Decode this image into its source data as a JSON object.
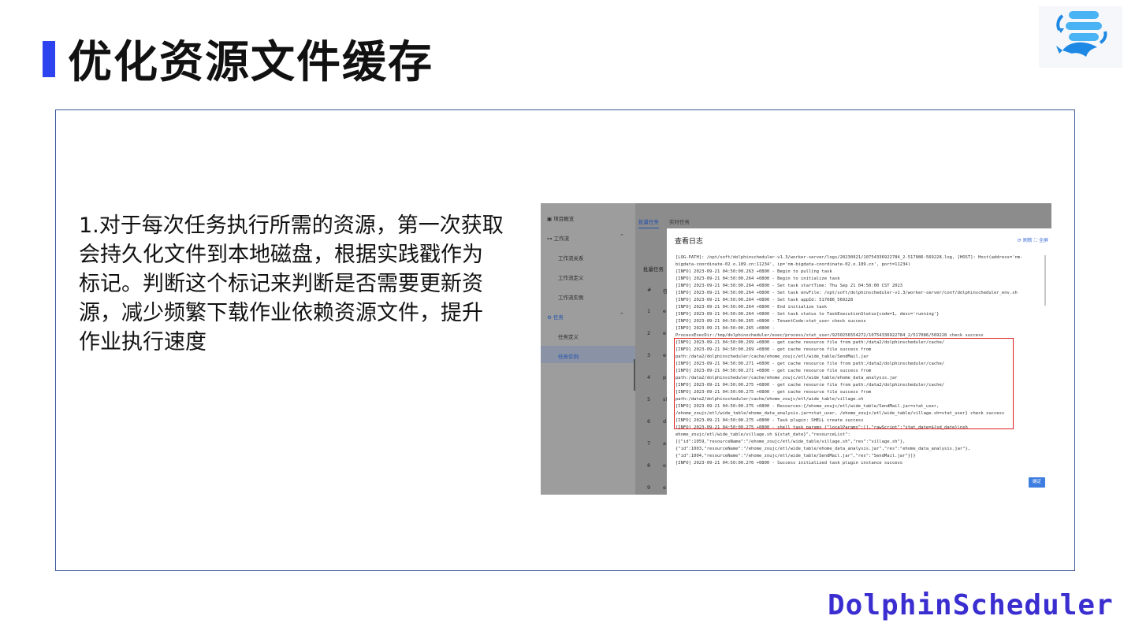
{
  "slide": {
    "title": "优化资源文件缓存",
    "body_lines": [
      "1.对于每次任务执行所需的资源，第一次获取",
      "会持久化文件到本地磁盘，根据实践戳作为",
      "标记。判断这个标记来判断是否需要更新资",
      "源，减少频繁下载作业依赖资源文件，提升",
      "作业执行速度"
    ],
    "brand": "DolphinScheduler"
  },
  "screenshot": {
    "sidebar": {
      "items": [
        "项目概览",
        "工作流",
        "工作流关系",
        "工作流定义",
        "工作流实例",
        "任务",
        "任务定义",
        "任务实例"
      ]
    },
    "tabs": [
      "批量任务",
      "实时任务"
    ],
    "background_label": "批量任务",
    "row_numbers": [
      "#",
      "1",
      "2",
      "3",
      "4",
      "5",
      "6",
      "7",
      "8",
      "9"
    ],
    "row_letters": [
      "任",
      "e",
      "e",
      "e",
      "p",
      "sl",
      "d",
      "a",
      "o",
      "e"
    ],
    "dialog": {
      "title": "查看日志",
      "refresh": "刷新",
      "fullscreen": "全屏",
      "ok": "确定",
      "log_lines": [
        "[LOG-PATH]: /opt/soft/dolphinscheduler-v1.3/worker-server/logs/20230921/10754336922784_2-517086-569228.log, [HOST]:  Host(address='nm-",
        "bigdata-coordinate-02.o.189.cn:11234', ip='nm-bigdata-coordinate-02.o.189.cn', port=11234)",
        "[INFO] 2023-09-21 04:50:00.263 +0800 - Begin to pulling task",
        "[INFO] 2023-09-21 04:50:00.264 +0800 - Begin to initialize task",
        "[INFO] 2023-09-21 04:50:00.264 +0800 - Set task startTime: Thu Sep 21 04:50:00 CST 2023",
        "[INFO] 2023-09-21 04:50:00.264 +0800 - Set task envFile: /opt/soft/dolphinscheduler-v1.3/worker-server/conf/dolphinscheduler_env.sh",
        "[INFO] 2023-09-21 04:50:00.264 +0800 - Set task appId: 517086_569228",
        "[INFO] 2023-09-21 04:50:00.264 +0800 - End initialize task",
        "[INFO] 2023-09-21 04:50:00.264 +0800 - Set task status to TaskExecutionStatus{code=1, desc='running'}",
        "[INFO] 2023-09-21 04:50:00.265 +0800 - TenantCode:stat_user check success",
        "[INFO] 2023-09-21 04:50:00.265 +0800 -",
        "ProcessExecDir:/tmp/dolphinscheduler/exec/process/stat_user/9250256554272/10754336922784_2/517086/569228 check success",
        "[INFO] 2023-09-21 04:50:00.269 +0800 - get cache resource file from path:/data2/dolphinscheduler/cache/",
        "[INFO] 2023-09-21 04:50:00.269 +0800 - get cache resource file success from",
        "path:/data2/dolphinscheduler/cache/ehome_zoujc/etl/wide_table/SendMail.jar",
        "[INFO] 2023-09-21 04:50:00.271 +0800 - get cache resource file from path:/data2/dolphinscheduler/cache/",
        "[INFO] 2023-09-21 04:50:00.271 +0800 - get cache resource file success from",
        "path:/data2/dolphinscheduler/cache/ehome_zoujc/etl/wide_table/ehome_data_analysis.jar",
        "[INFO] 2023-09-21 04:50:00.275 +0800 - get cache resource file from path:/data2/dolphinscheduler/cache/",
        "[INFO] 2023-09-21 04:50:00.275 +0800 - get cache resource file success from",
        "path:/data2/dolphinscheduler/cache/ehome_zoujc/etl/wide_table/village.sh",
        "[INFO] 2023-09-21 04:50:00.275 +0800 - Resources:{/ehome_zoujc/etl/wide_table/SendMail.jar=stat_user,",
        "/ehome_zoujc/etl/wide_table/ehome_data_analysis.jar=stat_user, /ehome_zoujc/etl/wide_table/village.sh=stat_user} check success",
        "[INFO] 2023-09-21 04:50:00.275 +0800 - Task plugin: SHELL create success",
        "[INFO] 2023-09-21 04:50:00.275 +0800 - shell task params {\"localParams\":[],\"rawScript\":\"stat_date=${sd_date}\\nsh",
        "ehome_zoujc/etl/wide_table/village.sh ${stat_date}\",\"resourceList\":",
        "[{\"id\":1059,\"resourceName\":\"/ehome_zoujc/etl/wide_table/village.sh\",\"res\":\"village.sh\"},",
        "{\"id\":1003,\"resourceName\":\"/ehome_zoujc/etl/wide_table/ehome_data_analysis.jar\",\"res\":\"ehome_data_analysis.jar\"},",
        "{\"id\":1004,\"resourceName\":\"/ehome_zoujc/etl/wide_table/SendMail.jar\",\"res\":\"SendMail.jar\"}]}",
        "[INFO] 2023-09-21 04:50:00.276 +0800 - Success initialized task plugin instance success"
      ]
    }
  },
  "colors": {
    "title_accent": "#2e43f0",
    "frame_border": "#3b5998",
    "brand": "#3a2ed0",
    "highlight_box": "#e02020",
    "ok_button": "#3d7ee0"
  },
  "icons": [
    "dolphinscheduler-logo-icon",
    "refresh-icon",
    "fullscreen-icon",
    "workflow-icon",
    "task-gear-icon",
    "overview-icon",
    "chevron-up-icon"
  ]
}
